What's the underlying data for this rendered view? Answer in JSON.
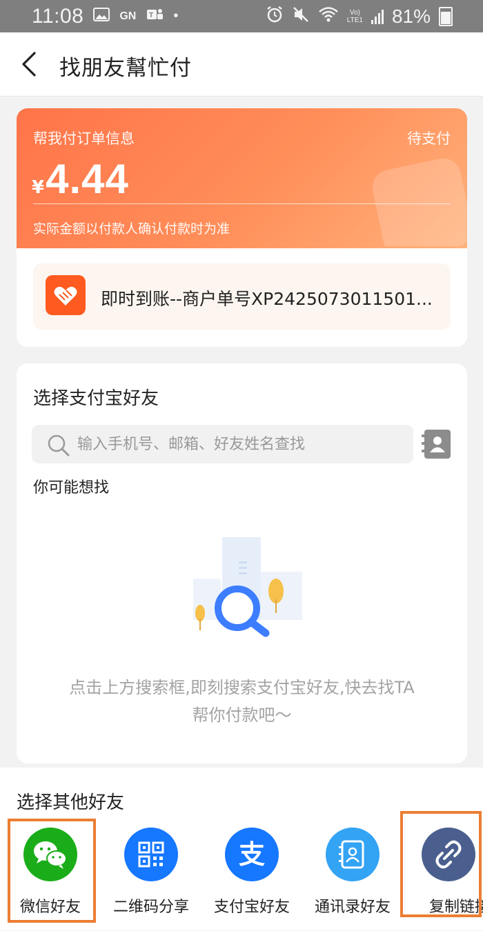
{
  "status_bar": {
    "time": "11:08",
    "battery": "81%"
  },
  "nav": {
    "title": "找朋友幫忙付"
  },
  "order": {
    "label": "帮我付订单信息",
    "status": "待支付",
    "currency": "¥",
    "amount": "4.44",
    "note": "实际金额以付款人确认付款时为准",
    "item_text": "即时到账--商户单号XP2425073011501..."
  },
  "friends": {
    "title": "选择支付宝好友",
    "search_placeholder": "输入手机号、邮箱、好友姓名查找",
    "maybe_label": "你可能想找",
    "empty_line1": "点击上方搜索框,即刻搜索支付宝好友,快去找TA",
    "empty_line2": "帮你付款吧～"
  },
  "share": {
    "title": "选择其他好友",
    "items": [
      {
        "label": "微信好友",
        "icon": "wechat-icon",
        "color": "#1aad19"
      },
      {
        "label": "二维码分享",
        "icon": "qr-code-icon",
        "color": "#1677ff"
      },
      {
        "label": "支付宝好友",
        "icon": "alipay-icon",
        "color": "#1677ff"
      },
      {
        "label": "通讯录好友",
        "icon": "address-book-icon",
        "color": "#33a3f4"
      },
      {
        "label": "复制链接",
        "icon": "link-icon",
        "color": "#4a5f8e"
      }
    ]
  },
  "colors": {
    "accent_orange": "#ff7449",
    "highlight_border": "#ec7d33"
  }
}
